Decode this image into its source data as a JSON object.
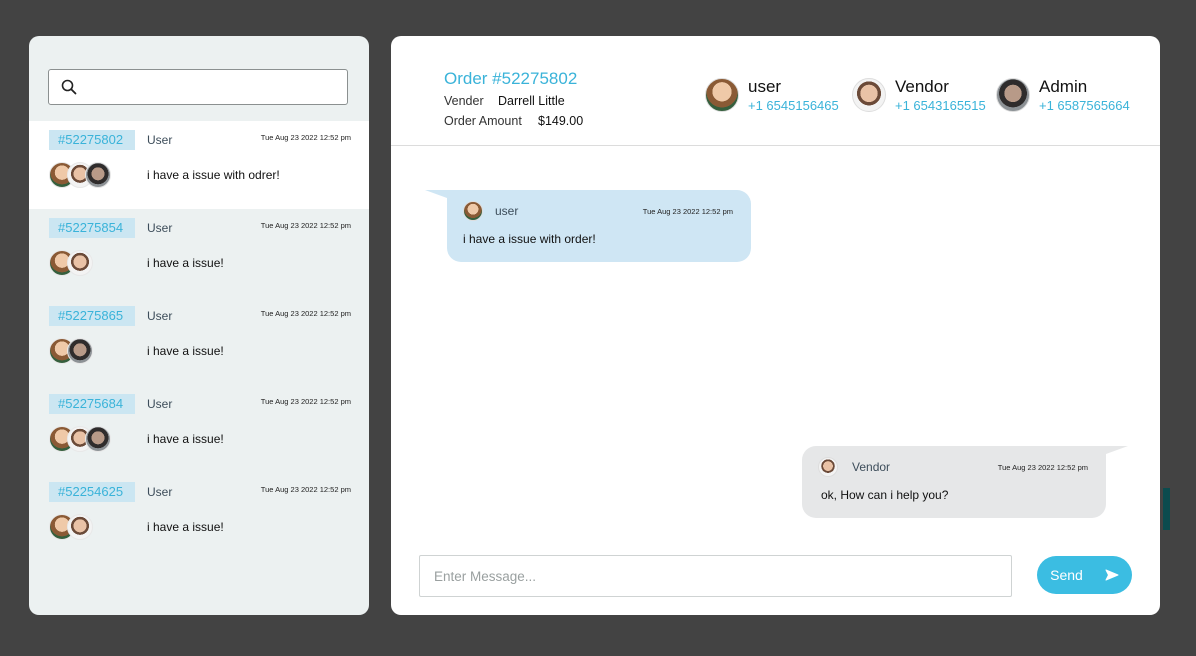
{
  "search": {
    "placeholder": ""
  },
  "chats": [
    {
      "order": "#52275802",
      "role": "User",
      "time": "Tue Aug 23 2022 12:52 pm",
      "message": "i have a issue with odrer!",
      "avatars": [
        "user",
        "vendor",
        "admin"
      ],
      "active": true
    },
    {
      "order": "#52275854",
      "role": "User",
      "time": "Tue Aug 23 2022 12:52 pm",
      "message": "i have a issue!",
      "avatars": [
        "user",
        "vendor"
      ],
      "active": false
    },
    {
      "order": "#52275865",
      "role": "User",
      "time": "Tue Aug 23 2022 12:52 pm",
      "message": "i have a issue!",
      "avatars": [
        "user",
        "admin"
      ],
      "active": false
    },
    {
      "order": "#52275684",
      "role": "User",
      "time": "Tue Aug 23 2022 12:52 pm",
      "message": "i have a issue!",
      "avatars": [
        "user",
        "vendor",
        "admin"
      ],
      "active": false
    },
    {
      "order": "#52254625",
      "role": "User",
      "time": "Tue Aug 23 2022 12:52 pm",
      "message": "i have a issue!",
      "avatars": [
        "user",
        "vendor"
      ],
      "active": false
    }
  ],
  "order": {
    "title": "Order #52275802",
    "vendor_label": "Vender",
    "vendor_value": "Darrell Little",
    "amount_label": "Order Amount",
    "amount_value": "$149.00"
  },
  "participants": [
    {
      "name": "user",
      "phone": "+1 6545156465",
      "avatar": "user"
    },
    {
      "name": "Vendor",
      "phone": "+1 6543165515",
      "avatar": "vendor"
    },
    {
      "name": "Admin",
      "phone": "+1 6587565664",
      "avatar": "admin"
    }
  ],
  "messages": {
    "incoming": {
      "sender": "user",
      "time": "Tue Aug 23 2022 12:52 pm",
      "text": "i have a issue with order!"
    },
    "outgoing": {
      "sender": "Vendor",
      "time": "Tue Aug 23 2022 12:52 pm",
      "text": "ok, How can i help you?"
    }
  },
  "composer": {
    "placeholder": "Enter Message...",
    "send_label": "Send"
  },
  "colors": {
    "accent": "#3ab3d9",
    "send_button": "#3bbde2",
    "incoming_bubble": "#cfe6f4",
    "outgoing_bubble": "#e6e7e8"
  }
}
